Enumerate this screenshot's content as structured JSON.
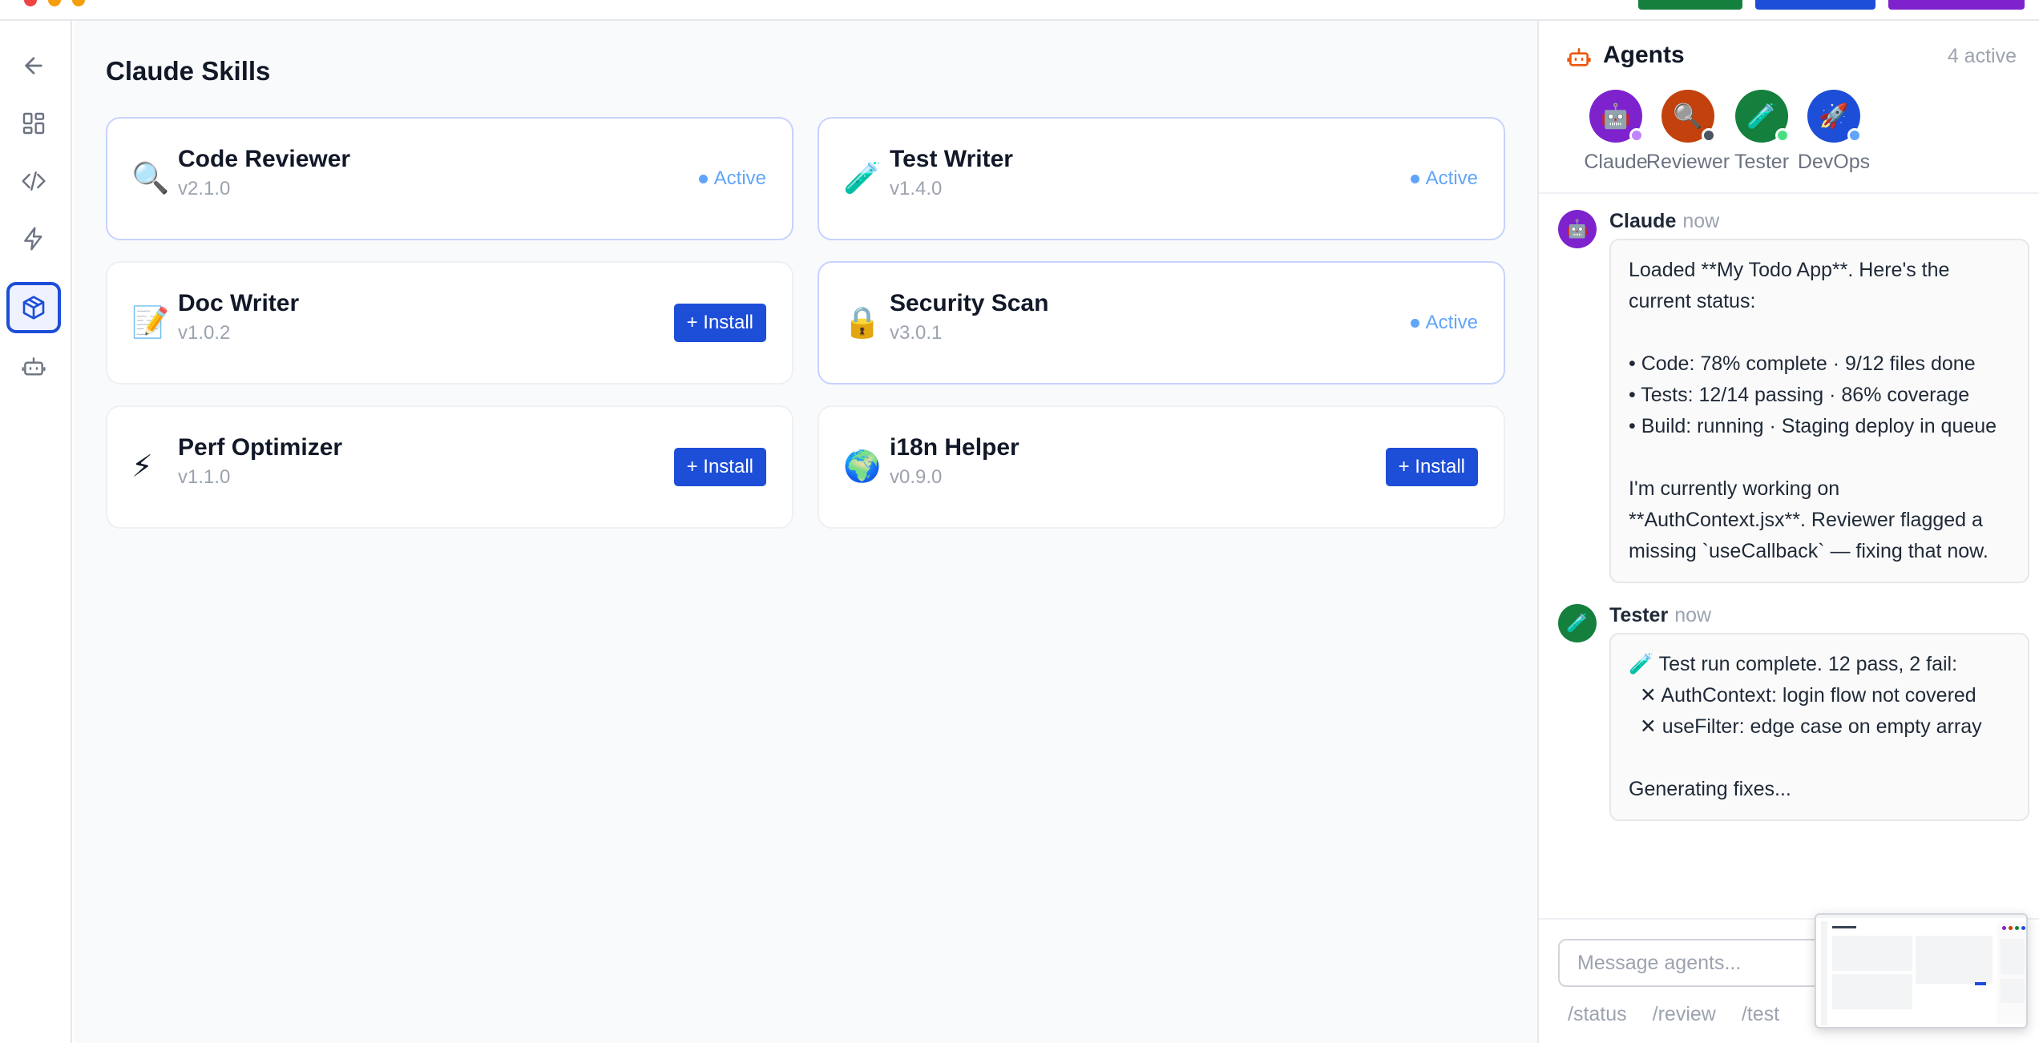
{
  "page_title": "Claude Skills",
  "rail": {
    "items": [
      {
        "name": "back",
        "icon": "arrow-left-icon",
        "active": false
      },
      {
        "name": "dashboard",
        "icon": "grid-icon",
        "active": false
      },
      {
        "name": "code",
        "icon": "code-icon",
        "active": false
      },
      {
        "name": "actions",
        "icon": "lightning-icon",
        "active": false
      },
      {
        "name": "skills",
        "icon": "cube-icon",
        "active": true
      },
      {
        "name": "agents",
        "icon": "robot-icon",
        "active": false
      }
    ]
  },
  "skills": [
    {
      "icon": "🔍",
      "name": "Code Reviewer",
      "version": "v2.1.0",
      "status": "Active"
    },
    {
      "icon": "🧪",
      "name": "Test Writer",
      "version": "v1.4.0",
      "status": "Active"
    },
    {
      "icon": "📝",
      "name": "Doc Writer",
      "version": "v1.0.2",
      "action": "+ Install"
    },
    {
      "icon": "🔒",
      "name": "Security Scan",
      "version": "v3.0.1",
      "status": "Active"
    },
    {
      "icon": "⚡",
      "name": "Perf Optimizer",
      "version": "v1.1.0",
      "action": "+ Install"
    },
    {
      "icon": "🌍",
      "name": "i18n Helper",
      "version": "v0.9.0",
      "action": "+ Install"
    }
  ],
  "agents_panel": {
    "title": "Agents",
    "count": "4 active",
    "agents": [
      {
        "name": "Claude",
        "icon": "🤖",
        "color": "#7e22ce",
        "status_color": "#c084fc"
      },
      {
        "name": "Reviewer",
        "icon": "🔍",
        "color": "#c2410c",
        "status_color": "#4b5563"
      },
      {
        "name": "Tester",
        "icon": "🧪",
        "color": "#15803d",
        "status_color": "#4ade80"
      },
      {
        "name": "DevOps",
        "icon": "🚀",
        "color": "#1d4ed8",
        "status_color": "#60a5fa"
      }
    ],
    "messages": [
      {
        "author": "Claude",
        "time": "now",
        "icon": "🤖",
        "color": "#7e22ce",
        "text": "Loaded **My Todo App**. Here's the current status:\n\n• Code: 78% complete · 9/12 files done\n• Tests: 12/14 passing · 86% coverage\n• Build: running · Staging deploy in queue\n\nI'm currently working on **AuthContext.jsx**. Reviewer flagged a missing `useCallback` — fixing that now."
      },
      {
        "author": "Tester",
        "time": "now",
        "icon": "🧪",
        "color": "#15803d",
        "text": "🧪 Test run complete. 12 pass, 2 fail:\n  ✕ AuthContext: login flow not covered\n  ✕ useFilter: edge case on empty array\n\nGenerating fixes..."
      }
    ],
    "input_placeholder": "Message agents...",
    "quick_commands": [
      "/status",
      "/review",
      "/test"
    ]
  },
  "colors": {
    "accent": "#1d4ed8",
    "active_status": "#60a5fa",
    "top_buttons": [
      "#15803d",
      "#1d4ed8",
      "#7e22ce"
    ]
  }
}
